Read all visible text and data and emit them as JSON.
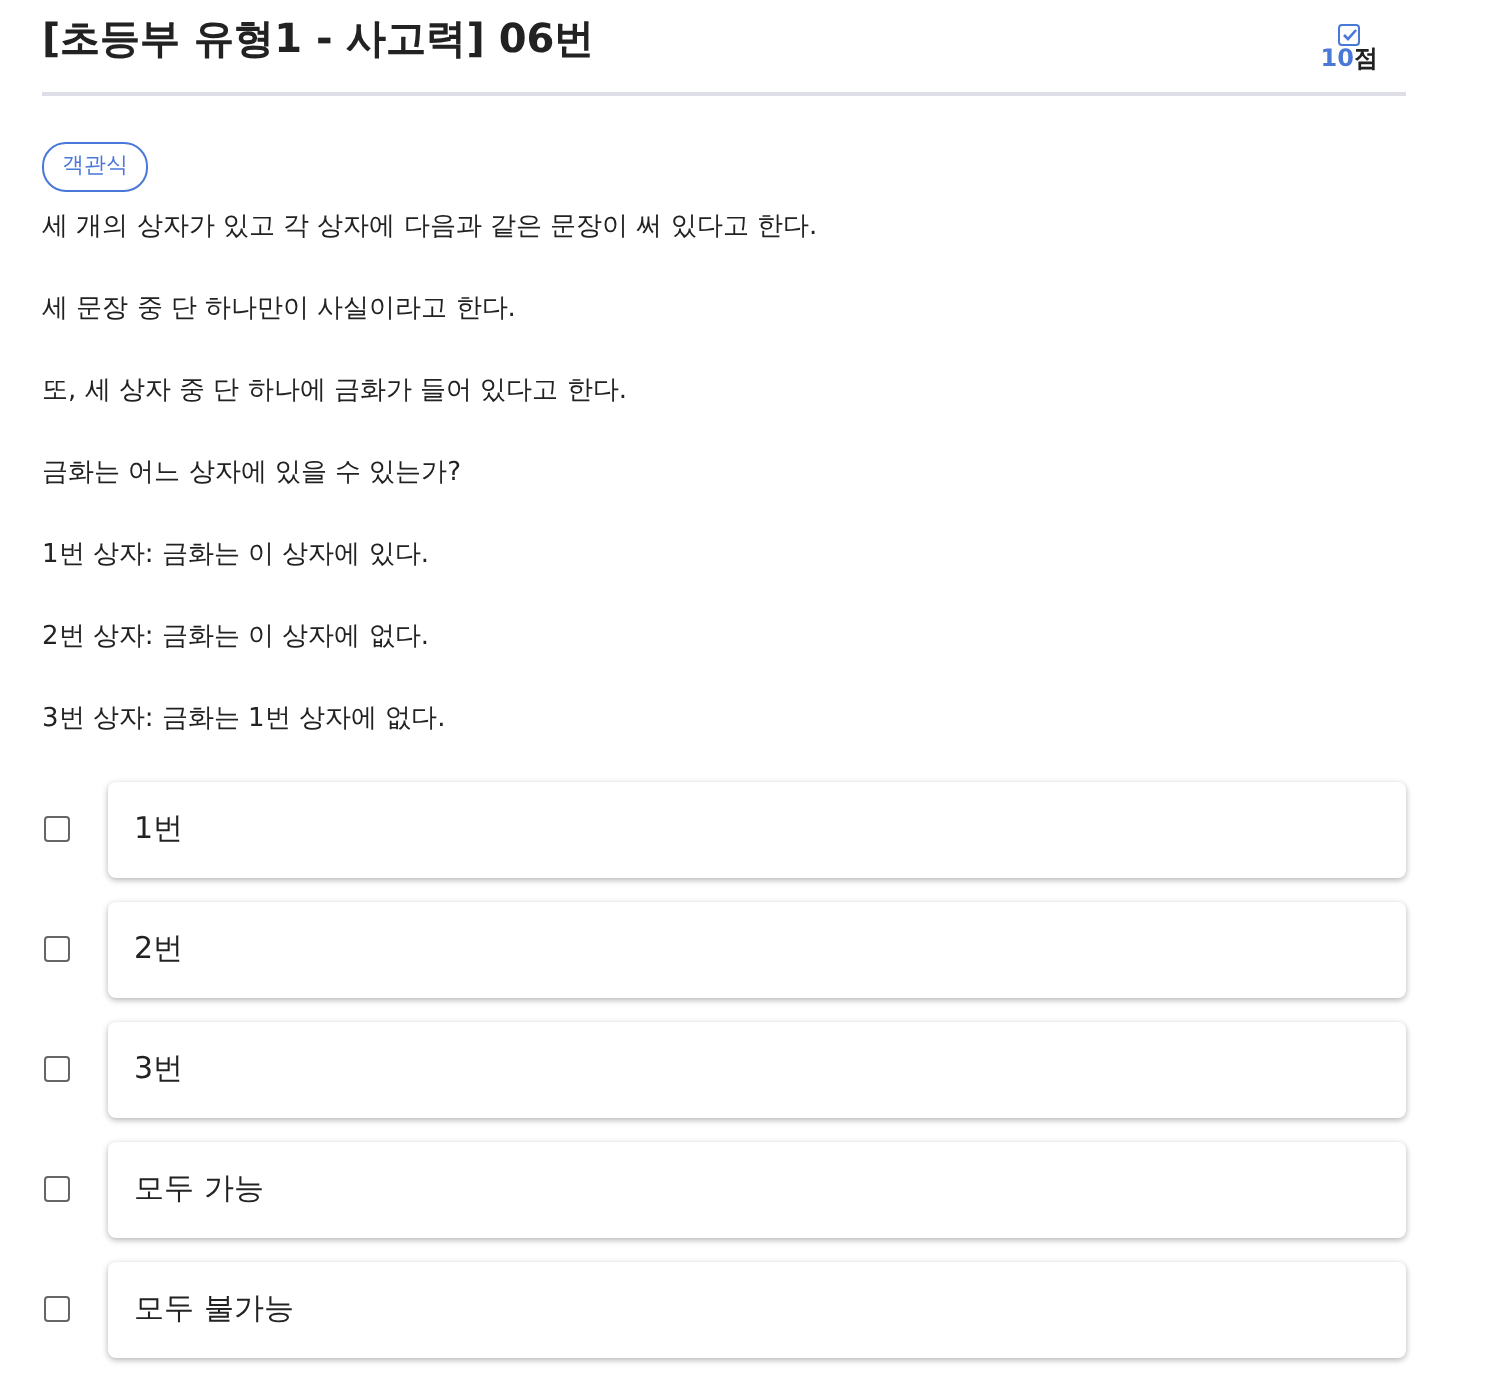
{
  "title": "[초등부 유형1 - 사고력] 06번",
  "score": {
    "checked": true,
    "value": "10",
    "unit": "점"
  },
  "question_type": "객관식",
  "paragraphs": [
    "세 개의 상자가 있고 각 상자에 다음과 같은 문장이 써 있다고 한다.",
    "세 문장 중 단 하나만이 사실이라고 한다.",
    "또, 세 상자 중 단 하나에 금화가 들어 있다고 한다.",
    "금화는 어느 상자에 있을 수 있는가?",
    "1번 상자: 금화는 이 상자에 있다.",
    "2번 상자: 금화는 이 상자에 없다.",
    "3번 상자: 금화는 1번 상자에 없다."
  ],
  "options": [
    {
      "label": "1번",
      "checked": false
    },
    {
      "label": "2번",
      "checked": false
    },
    {
      "label": "3번",
      "checked": false
    },
    {
      "label": "모두 가능",
      "checked": false
    },
    {
      "label": "모두 불가능",
      "checked": false
    }
  ]
}
